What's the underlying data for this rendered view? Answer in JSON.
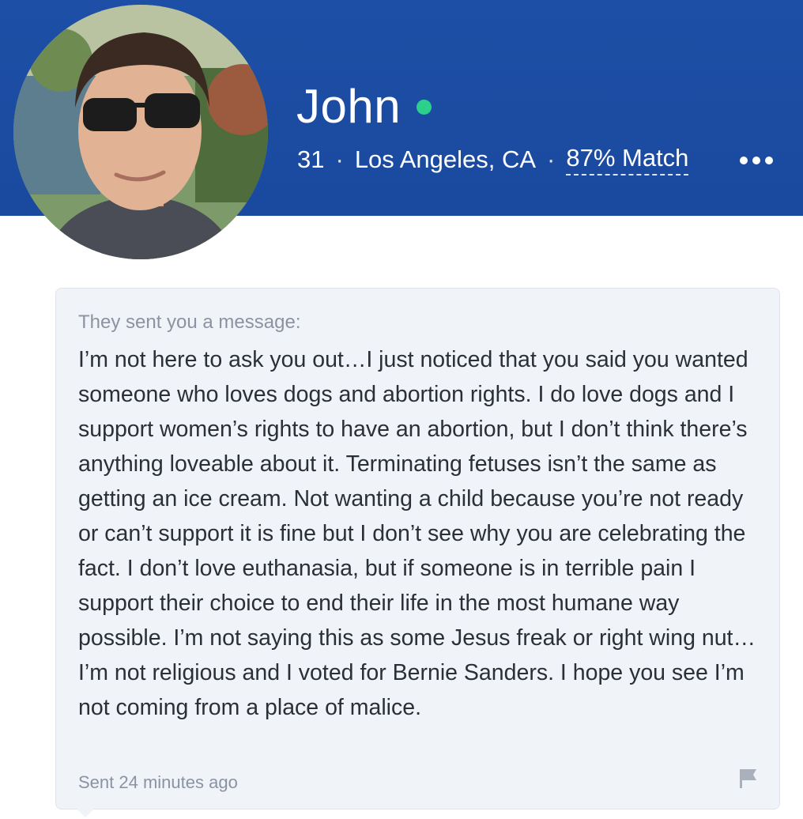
{
  "profile": {
    "name": "John",
    "online": true,
    "age": "31",
    "location": "Los Angeles, CA",
    "match": "87% Match",
    "separator": "·"
  },
  "message": {
    "label": "They sent you a message:",
    "body": "I’m not here to ask you out…I just noticed that you said you wanted someone who loves dogs and abortion rights. I do love dogs and I support women’s rights to have an abortion, but I don’t think there’s anything loveable about it. Terminating fetuses isn’t the same as getting an ice cream. Not wanting a child because you’re not ready or can’t support it is fine but I don’t see why you are celebrating the fact. I don’t love euthanasia, but if someone is in terrible pain I support their choice to end their life in the most humane way possible. I’m not saying this as some Jesus freak or right wing nut…I’m not religious and I voted for Bernie Sanders. I hope you see I’m not coming from a place of malice.",
    "sent_time": "Sent 24 minutes ago"
  },
  "icons": {
    "more": "more-icon",
    "flag": "flag-icon",
    "online": "online-dot-icon"
  },
  "colors": {
    "header": "#1d4fa6",
    "online": "#2bd18a",
    "card": "#f0f3f8"
  }
}
